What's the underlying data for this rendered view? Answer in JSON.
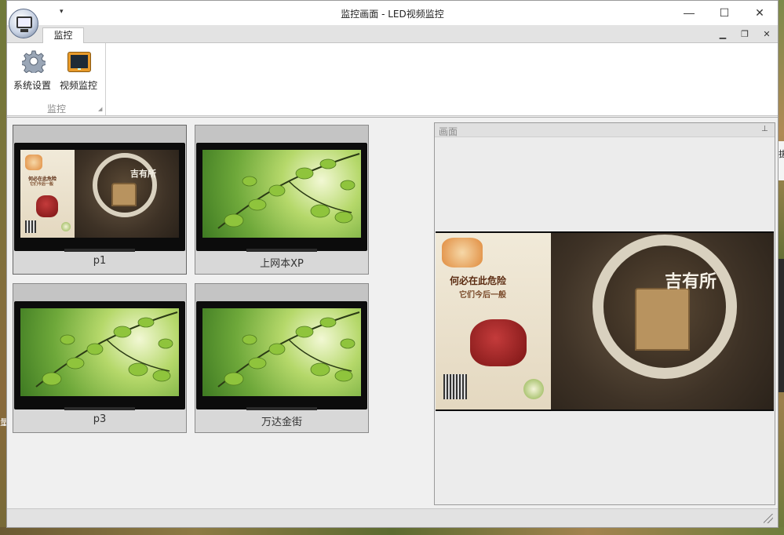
{
  "window": {
    "title": "监控画面 - LED视频监控",
    "app_icon": "monitor-app-icon",
    "qat_arrow": "▾",
    "controls": {
      "minimize": "—",
      "maximize": "☐",
      "close": "✕"
    }
  },
  "ribbon": {
    "tabs": [
      {
        "label": "监控"
      }
    ],
    "mdi_controls": {
      "minimize": "▁",
      "restore": "❐",
      "close": "✕"
    },
    "group_label": "监控",
    "group_launcher": "◢",
    "buttons": [
      {
        "label": "系统设置",
        "icon": "gear-icon"
      },
      {
        "label": "视频监控",
        "icon": "monitor-icon"
      }
    ]
  },
  "screens": [
    {
      "label": "p1",
      "content": "ad",
      "selected": true
    },
    {
      "label": "上网本XP",
      "content": "leaves"
    },
    {
      "label": "p3",
      "content": "leaves"
    },
    {
      "label": "万达金街",
      "content": "leaves"
    }
  ],
  "preview": {
    "title": "画面",
    "pin_icon": "pin-icon",
    "pin_glyph": "⊥"
  },
  "ad_text": {
    "headline": "何必在此危险",
    "subline": "它们今后一般",
    "calligraphy": "吉有所"
  },
  "desktop": {
    "right_peek_text": "拔",
    "left_peek_text": "量"
  },
  "colors": {
    "window_bg": "#f0f0f0",
    "ribbon_bg": "#ffffff",
    "thumb_bar": "#c4c4c4",
    "monitor_orange": "#e89a2a"
  }
}
